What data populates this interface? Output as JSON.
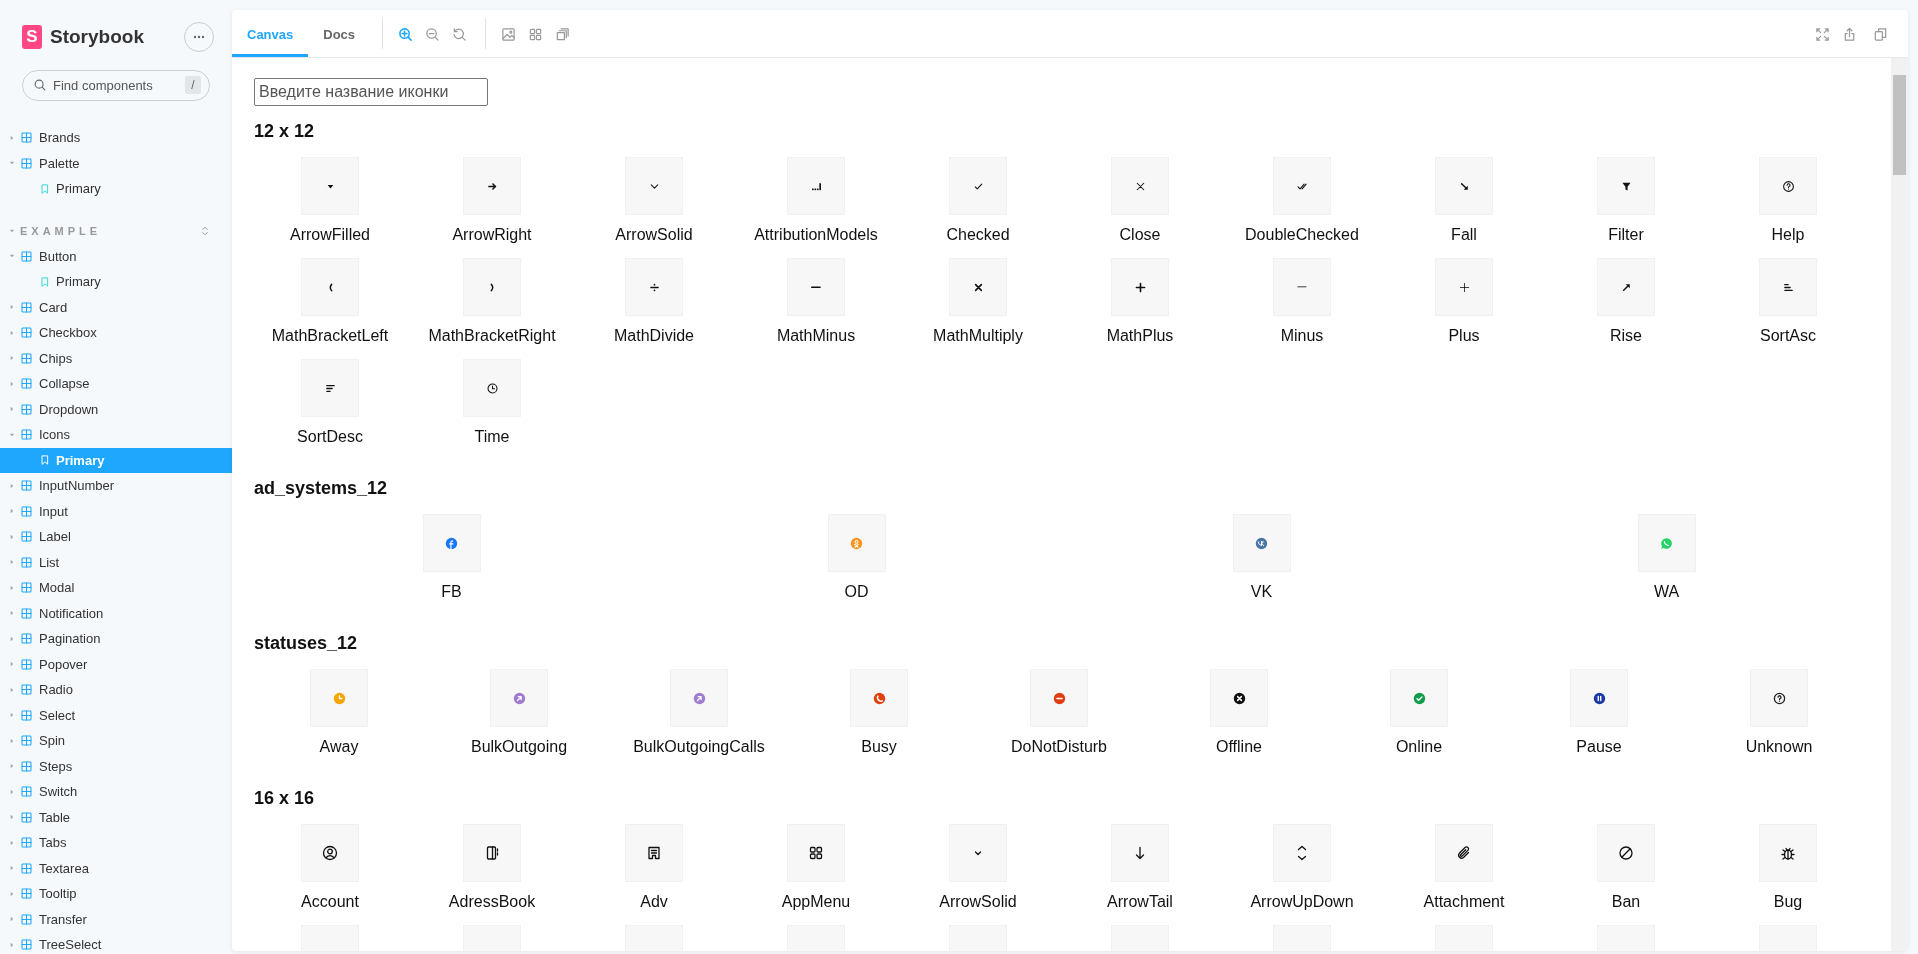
{
  "sidebar": {
    "logo_mark": "S",
    "logo": "Storybook",
    "search": {
      "placeholder": "Find components",
      "shortcut": "/"
    },
    "tree": [
      {
        "label": "Brands",
        "expanded": false
      },
      {
        "label": "Palette",
        "expanded": true,
        "children": [
          {
            "label": "Primary",
            "selected": false
          }
        ]
      }
    ],
    "groups": [
      {
        "title": "EXAMPLE",
        "expanded": true,
        "items": [
          {
            "label": "Button",
            "expanded": true,
            "children": [
              {
                "label": "Primary",
                "selected": false
              }
            ]
          },
          {
            "label": "Card",
            "expanded": false
          },
          {
            "label": "Checkbox",
            "expanded": false
          },
          {
            "label": "Chips",
            "expanded": false
          },
          {
            "label": "Collapse",
            "expanded": false
          },
          {
            "label": "Dropdown",
            "expanded": false
          },
          {
            "label": "Icons",
            "expanded": true,
            "children": [
              {
                "label": "Primary",
                "selected": true
              }
            ]
          },
          {
            "label": "InputNumber",
            "expanded": false
          },
          {
            "label": "Input",
            "expanded": false
          },
          {
            "label": "Label",
            "expanded": false
          },
          {
            "label": "List",
            "expanded": false
          },
          {
            "label": "Modal",
            "expanded": false
          },
          {
            "label": "Notification",
            "expanded": false
          },
          {
            "label": "Pagination",
            "expanded": false
          },
          {
            "label": "Popover",
            "expanded": false
          },
          {
            "label": "Radio",
            "expanded": false
          },
          {
            "label": "Select",
            "expanded": false
          },
          {
            "label": "Spin",
            "expanded": false
          },
          {
            "label": "Steps",
            "expanded": false
          },
          {
            "label": "Switch",
            "expanded": false
          },
          {
            "label": "Table",
            "expanded": false
          },
          {
            "label": "Tabs",
            "expanded": false
          },
          {
            "label": "Textarea",
            "expanded": false
          },
          {
            "label": "Tooltip",
            "expanded": false
          },
          {
            "label": "Transfer",
            "expanded": false
          },
          {
            "label": "TreeSelect",
            "expanded": false
          }
        ]
      }
    ]
  },
  "toolbar": {
    "tabs": [
      {
        "label": "Canvas",
        "selected": true
      },
      {
        "label": "Docs",
        "selected": false
      }
    ],
    "tool_groups": [
      [
        {
          "kind": "zoom-in",
          "active": true
        },
        {
          "kind": "zoom-out",
          "active": false
        },
        {
          "kind": "zoom-reset",
          "active": false
        }
      ],
      [
        {
          "kind": "background",
          "active": false
        },
        {
          "kind": "grid",
          "active": false
        },
        {
          "kind": "outline",
          "active": false
        }
      ]
    ],
    "actions": [
      {
        "kind": "fullscreen"
      },
      {
        "kind": "share"
      },
      {
        "kind": "copy"
      }
    ]
  },
  "canvas": {
    "search": {
      "placeholder": "Введите название иконки"
    },
    "sections": [
      {
        "title": "12 x 12",
        "items": [
          {
            "kind": "icon",
            "name": "ArrowFilled"
          },
          {
            "kind": "icon",
            "name": "ArrowRight"
          },
          {
            "kind": "icon",
            "name": "ArrowSolid"
          },
          {
            "kind": "icon",
            "name": "AttributionModels"
          },
          {
            "kind": "icon",
            "name": "Checked"
          },
          {
            "kind": "icon",
            "name": "Close"
          },
          {
            "kind": "icon",
            "name": "DoubleChecked"
          },
          {
            "kind": "icon",
            "name": "Fall"
          },
          {
            "kind": "icon",
            "name": "Filter"
          },
          {
            "kind": "icon",
            "name": "Help"
          },
          {
            "kind": "icon",
            "name": "MathBracketLeft"
          },
          {
            "kind": "icon",
            "name": "MathBracketRight"
          },
          {
            "kind": "icon",
            "name": "MathDivide"
          },
          {
            "kind": "icon",
            "name": "MathMinus"
          },
          {
            "kind": "icon",
            "name": "MathMultiply"
          },
          {
            "kind": "icon",
            "name": "MathPlus"
          },
          {
            "kind": "icon",
            "name": "Minus"
          },
          {
            "kind": "icon",
            "name": "Plus"
          },
          {
            "kind": "icon",
            "name": "Rise"
          },
          {
            "kind": "icon",
            "name": "SortAsc"
          },
          {
            "kind": "icon",
            "name": "SortDesc"
          },
          {
            "kind": "icon",
            "name": "Time"
          }
        ]
      },
      {
        "title": "ad_systems_12",
        "items": [
          {
            "kind": "icon",
            "name": "FB",
            "color": "#1877f2"
          },
          {
            "kind": "icon",
            "name": "OD",
            "color": "#f7931e"
          },
          {
            "kind": "icon",
            "name": "VK",
            "color": "#4a76a8"
          },
          {
            "kind": "icon",
            "name": "WA",
            "color": "#25d366"
          }
        ]
      },
      {
        "title": "statuses_12",
        "items": [
          {
            "kind": "icon",
            "name": "Away",
            "color": "#f7a600"
          },
          {
            "kind": "icon",
            "name": "BulkOutgoing",
            "color": "#a07cd0"
          },
          {
            "kind": "icon",
            "name": "BulkOutgoingCalls",
            "color": "#a07cd0"
          },
          {
            "kind": "icon",
            "name": "Busy",
            "color": "#e0400c"
          },
          {
            "kind": "icon",
            "name": "DoNotDisturb",
            "color": "#de3e12"
          },
          {
            "kind": "icon",
            "name": "Offline",
            "color": "#111111"
          },
          {
            "kind": "icon",
            "name": "Online",
            "color": "#119c4a"
          },
          {
            "kind": "icon",
            "name": "Pause",
            "color": "#1b3aa8"
          },
          {
            "kind": "icon",
            "name": "Unknown",
            "color": "#222222"
          }
        ]
      },
      {
        "title": "16 x 16",
        "items": [
          {
            "kind": "icon",
            "name": "Account"
          },
          {
            "kind": "icon",
            "name": "AdressBook"
          },
          {
            "kind": "icon",
            "name": "Adv"
          },
          {
            "kind": "icon",
            "name": "AppMenu"
          },
          {
            "kind": "icon",
            "name": "ArrowSolid"
          },
          {
            "kind": "icon",
            "name": "ArrowTail"
          },
          {
            "kind": "icon",
            "name": "ArrowUpDown"
          },
          {
            "kind": "icon",
            "name": "Attachment"
          },
          {
            "kind": "icon",
            "name": "Ban"
          },
          {
            "kind": "icon",
            "name": "Bug"
          },
          {
            "kind": "cut"
          },
          {
            "kind": "cut"
          },
          {
            "kind": "cut"
          },
          {
            "kind": "cut"
          },
          {
            "kind": "cut"
          },
          {
            "kind": "cut"
          },
          {
            "kind": "cut"
          },
          {
            "kind": "cut"
          },
          {
            "kind": "cut"
          },
          {
            "kind": "cut"
          }
        ]
      }
    ]
  }
}
